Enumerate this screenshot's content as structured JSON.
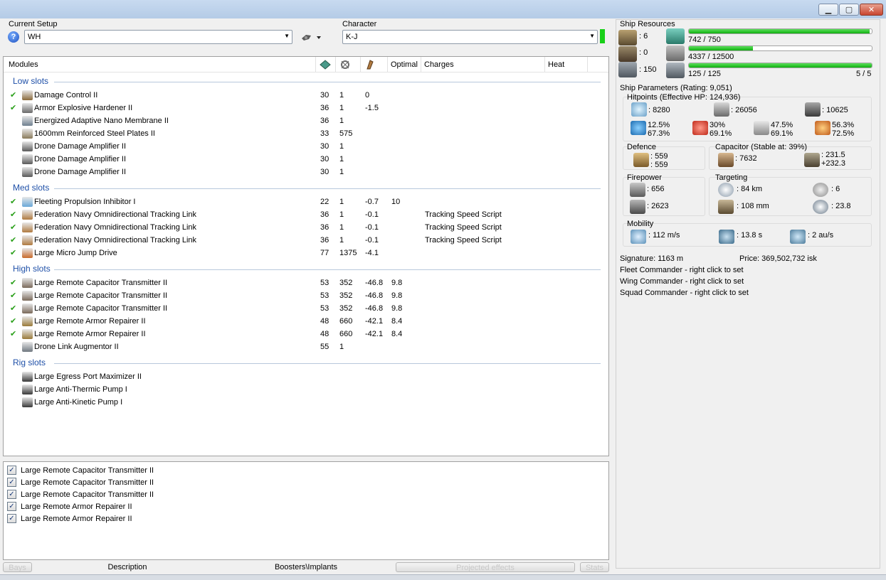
{
  "setup": {
    "label": "Current Setup",
    "value": "WH"
  },
  "character": {
    "label": "Character",
    "value": "K-J"
  },
  "modules": {
    "headers": {
      "modules": "Modules",
      "optimal": "Optimal",
      "charges": "Charges",
      "heat": "Heat"
    },
    "sections": {
      "low": "Low slots",
      "med": "Med slots",
      "high": "High slots",
      "rig": "Rig slots"
    },
    "low": [
      {
        "check": "✔",
        "name": "Damage Control II",
        "c1": "30",
        "c2": "1",
        "c3": "0",
        "c4": "",
        "c5": "",
        "color": "#8a6a3a"
      },
      {
        "check": "✔",
        "name": "Armor Explosive Hardener II",
        "c1": "36",
        "c2": "1",
        "c3": "-1.5",
        "c4": "",
        "c5": "",
        "color": "#6a6a6a"
      },
      {
        "check": "",
        "name": "Energized Adaptive Nano Membrane II",
        "c1": "36",
        "c2": "1",
        "c3": "",
        "c4": "",
        "c5": "",
        "color": "#6f7f8f"
      },
      {
        "check": "",
        "name": "1600mm Reinforced Steel Plates II",
        "c1": "33",
        "c2": "575",
        "c3": "",
        "c4": "",
        "c5": "",
        "color": "#8a7a5a"
      },
      {
        "check": "",
        "name": "Drone Damage Amplifier II",
        "c1": "30",
        "c2": "1",
        "c3": "",
        "c4": "",
        "c5": "",
        "color": "#5a5a5a"
      },
      {
        "check": "",
        "name": "Drone Damage Amplifier II",
        "c1": "30",
        "c2": "1",
        "c3": "",
        "c4": "",
        "c5": "",
        "color": "#5a5a5a"
      },
      {
        "check": "",
        "name": "Drone Damage Amplifier II",
        "c1": "30",
        "c2": "1",
        "c3": "",
        "c4": "",
        "c5": "",
        "color": "#5a5a5a"
      }
    ],
    "med": [
      {
        "check": "✔",
        "name": "Fleeting Propulsion Inhibitor I",
        "c1": "22",
        "c2": "1",
        "c3": "-0.7",
        "c4": "10",
        "c5": "",
        "color": "#6aa8d8"
      },
      {
        "check": "✔",
        "name": "Federation Navy Omnidirectional Tracking Link",
        "c1": "36",
        "c2": "1",
        "c3": "-0.1",
        "c4": "",
        "c5": "Tracking Speed Script",
        "color": "#b07a40"
      },
      {
        "check": "✔",
        "name": "Federation Navy Omnidirectional Tracking Link",
        "c1": "36",
        "c2": "1",
        "c3": "-0.1",
        "c4": "",
        "c5": "Tracking Speed Script",
        "color": "#b07a40"
      },
      {
        "check": "✔",
        "name": "Federation Navy Omnidirectional Tracking Link",
        "c1": "36",
        "c2": "1",
        "c3": "-0.1",
        "c4": "",
        "c5": "Tracking Speed Script",
        "color": "#b07a40"
      },
      {
        "check": "✔",
        "name": "Large Micro Jump Drive",
        "c1": "77",
        "c2": "1375",
        "c3": "-4.1",
        "c4": "",
        "c5": "",
        "color": "#c86a2a"
      }
    ],
    "high": [
      {
        "check": "✔",
        "name": "Large Remote Capacitor Transmitter II",
        "c1": "53",
        "c2": "352",
        "c3": "-46.8",
        "c4": "9.8",
        "c5": "",
        "color": "#7a6a5a"
      },
      {
        "check": "✔",
        "name": "Large Remote Capacitor Transmitter II",
        "c1": "53",
        "c2": "352",
        "c3": "-46.8",
        "c4": "9.8",
        "c5": "",
        "color": "#7a6a5a"
      },
      {
        "check": "✔",
        "name": "Large Remote Capacitor Transmitter II",
        "c1": "53",
        "c2": "352",
        "c3": "-46.8",
        "c4": "9.8",
        "c5": "",
        "color": "#7a6a5a"
      },
      {
        "check": "✔",
        "name": "Large Remote Armor Repairer II",
        "c1": "48",
        "c2": "660",
        "c3": "-42.1",
        "c4": "8.4",
        "c5": "",
        "color": "#9a7a3a"
      },
      {
        "check": "✔",
        "name": "Large Remote Armor Repairer II",
        "c1": "48",
        "c2": "660",
        "c3": "-42.1",
        "c4": "8.4",
        "c5": "",
        "color": "#9a7a3a"
      },
      {
        "check": "",
        "name": "Drone Link Augmentor II",
        "c1": "55",
        "c2": "1",
        "c3": "",
        "c4": "",
        "c5": "",
        "color": "#707880"
      }
    ],
    "rig": [
      {
        "check": "",
        "name": "Large Egress Port Maximizer II",
        "c1": "",
        "c2": "",
        "c3": "",
        "c4": "",
        "c5": "",
        "color": "#3a3a3a"
      },
      {
        "check": "",
        "name": "Large Anti-Thermic Pump I",
        "c1": "",
        "c2": "",
        "c3": "",
        "c4": "",
        "c5": "",
        "color": "#3a3a3a"
      },
      {
        "check": "",
        "name": "Large Anti-Kinetic Pump I",
        "c1": "",
        "c2": "",
        "c3": "",
        "c4": "",
        "c5": "",
        "color": "#3a3a3a"
      }
    ]
  },
  "projected": {
    "check": "✓",
    "items": [
      "Large Remote Capacitor Transmitter II",
      "Large Remote Capacitor Transmitter II",
      "Large Remote Capacitor Transmitter II",
      "Large Remote Armor Repairer II",
      "Large Remote Armor Repairer II"
    ]
  },
  "bottom_tabs": {
    "bays": "Bays",
    "description": "Description",
    "boosters": "Boosters\\Implants",
    "projected": "Projected effects",
    "stats": "Stats"
  },
  "resources": {
    "label": "Ship Resources",
    "hardpoints": [
      ": 6",
      ": 0",
      ": 150"
    ],
    "cpu": {
      "text": "742 / 750",
      "fill": 0.99
    },
    "powergrid": {
      "text": "4337 / 12500",
      "fill": 0.35
    },
    "bandwidth": {
      "text": "125 / 125",
      "fill": 1.0,
      "drones": "5 / 5"
    }
  },
  "params": {
    "label": "Ship Parameters (Rating: 9,051)",
    "hitpoints": {
      "label": "Hitpoints (Effective HP: 124,936)",
      "shield": ": 8280",
      "armor": ": 26056",
      "structure": ": 10625",
      "em": [
        "12.5%",
        "67.3%"
      ],
      "thermal": [
        "30%",
        "69.1%"
      ],
      "kinetic": [
        "47.5%",
        "69.1%"
      ],
      "explosive": [
        "56.3%",
        "72.5%"
      ]
    },
    "defence": {
      "label": "Defence",
      "values": [
        ": 559",
        ": 559"
      ]
    },
    "capacitor": {
      "label": "Capacitor (Stable at: 39%)",
      "amount": ": 7632",
      "rates": [
        ": 231.5",
        "+232.3"
      ]
    },
    "firepower": {
      "label": "Firepower",
      "dps": ": 656",
      "volley": ": 2623"
    },
    "targeting": {
      "label": "Targeting",
      "range": ": 84 km",
      "resolution": ": 108 mm",
      "targets": ": 6",
      "sensor": ": 23.8"
    },
    "mobility": {
      "label": "Mobility",
      "speed": ": 112 m/s",
      "align": ": 13.8 s",
      "warp": ": 2 au/s"
    },
    "signature": "Signature: 1163 m",
    "price": "Price: 369,502,732 isk",
    "fleet": "Fleet Commander - right click to set",
    "wing": "Wing Commander - right click to set",
    "squad": "Squad Commander - right click to set"
  },
  "window": {
    "minimize": "▁",
    "maximize": "▢",
    "close": "✕"
  },
  "glyphs": {
    "help": "?",
    "arrow": "▼"
  }
}
